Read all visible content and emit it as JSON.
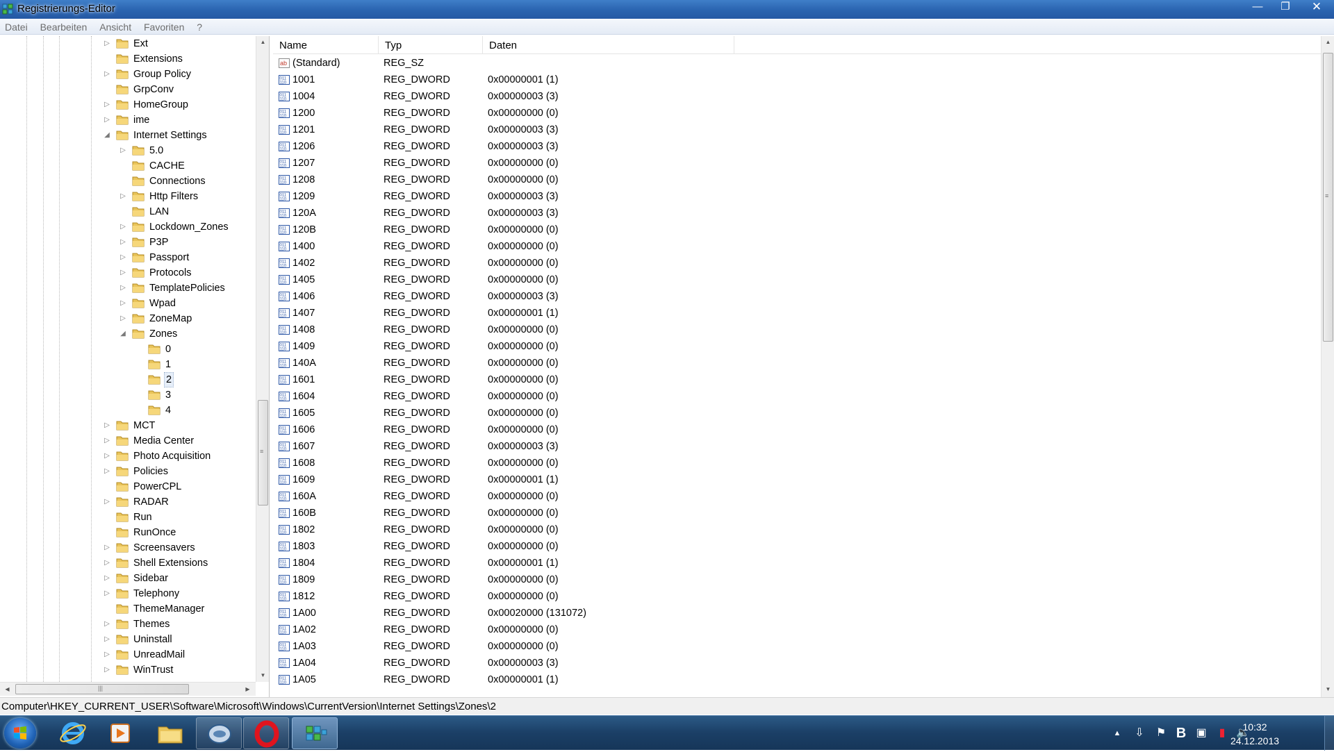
{
  "window": {
    "title": "Registrierungs-Editor",
    "minimize": "—",
    "maximize": "❐",
    "close": "✕"
  },
  "menu": [
    "Datei",
    "Bearbeiten",
    "Ansicht",
    "Favoriten",
    "?"
  ],
  "tree": [
    {
      "label": "Ext",
      "level": 0,
      "exp": "collapsed"
    },
    {
      "label": "Extensions",
      "level": 0,
      "exp": "none"
    },
    {
      "label": "Group Policy",
      "level": 0,
      "exp": "collapsed"
    },
    {
      "label": "GrpConv",
      "level": 0,
      "exp": "none"
    },
    {
      "label": "HomeGroup",
      "level": 0,
      "exp": "collapsed"
    },
    {
      "label": "ime",
      "level": 0,
      "exp": "collapsed"
    },
    {
      "label": "Internet Settings",
      "level": 0,
      "exp": "expanded"
    },
    {
      "label": "5.0",
      "level": 1,
      "exp": "collapsed"
    },
    {
      "label": "CACHE",
      "level": 1,
      "exp": "none"
    },
    {
      "label": "Connections",
      "level": 1,
      "exp": "none"
    },
    {
      "label": "Http Filters",
      "level": 1,
      "exp": "collapsed"
    },
    {
      "label": "LAN",
      "level": 1,
      "exp": "none"
    },
    {
      "label": "Lockdown_Zones",
      "level": 1,
      "exp": "collapsed"
    },
    {
      "label": "P3P",
      "level": 1,
      "exp": "collapsed"
    },
    {
      "label": "Passport",
      "level": 1,
      "exp": "collapsed"
    },
    {
      "label": "Protocols",
      "level": 1,
      "exp": "collapsed"
    },
    {
      "label": "TemplatePolicies",
      "level": 1,
      "exp": "collapsed"
    },
    {
      "label": "Wpad",
      "level": 1,
      "exp": "collapsed"
    },
    {
      "label": "ZoneMap",
      "level": 1,
      "exp": "collapsed"
    },
    {
      "label": "Zones",
      "level": 1,
      "exp": "expanded"
    },
    {
      "label": "0",
      "level": 2,
      "exp": "none"
    },
    {
      "label": "1",
      "level": 2,
      "exp": "none"
    },
    {
      "label": "2",
      "level": 2,
      "exp": "none",
      "selected": true
    },
    {
      "label": "3",
      "level": 2,
      "exp": "none"
    },
    {
      "label": "4",
      "level": 2,
      "exp": "none"
    },
    {
      "label": "MCT",
      "level": 0,
      "exp": "collapsed"
    },
    {
      "label": "Media Center",
      "level": 0,
      "exp": "collapsed"
    },
    {
      "label": "Photo Acquisition",
      "level": 0,
      "exp": "collapsed"
    },
    {
      "label": "Policies",
      "level": 0,
      "exp": "collapsed"
    },
    {
      "label": "PowerCPL",
      "level": 0,
      "exp": "none"
    },
    {
      "label": "RADAR",
      "level": 0,
      "exp": "collapsed"
    },
    {
      "label": "Run",
      "level": 0,
      "exp": "none"
    },
    {
      "label": "RunOnce",
      "level": 0,
      "exp": "none"
    },
    {
      "label": "Screensavers",
      "level": 0,
      "exp": "collapsed"
    },
    {
      "label": "Shell Extensions",
      "level": 0,
      "exp": "collapsed"
    },
    {
      "label": "Sidebar",
      "level": 0,
      "exp": "collapsed"
    },
    {
      "label": "Telephony",
      "level": 0,
      "exp": "collapsed"
    },
    {
      "label": "ThemeManager",
      "level": 0,
      "exp": "none"
    },
    {
      "label": "Themes",
      "level": 0,
      "exp": "collapsed"
    },
    {
      "label": "Uninstall",
      "level": 0,
      "exp": "collapsed"
    },
    {
      "label": "UnreadMail",
      "level": 0,
      "exp": "collapsed"
    },
    {
      "label": "WinTrust",
      "level": 0,
      "exp": "collapsed"
    }
  ],
  "list": {
    "columns": [
      "Name",
      "Typ",
      "Daten"
    ],
    "rows": [
      {
        "name": "(Standard)",
        "type": "REG_SZ",
        "data": "",
        "icon": "string-value-icon"
      },
      {
        "name": "1001",
        "type": "REG_DWORD",
        "data": "0x00000001 (1)",
        "icon": "binary-value-icon"
      },
      {
        "name": "1004",
        "type": "REG_DWORD",
        "data": "0x00000003 (3)",
        "icon": "binary-value-icon"
      },
      {
        "name": "1200",
        "type": "REG_DWORD",
        "data": "0x00000000 (0)",
        "icon": "binary-value-icon"
      },
      {
        "name": "1201",
        "type": "REG_DWORD",
        "data": "0x00000003 (3)",
        "icon": "binary-value-icon"
      },
      {
        "name": "1206",
        "type": "REG_DWORD",
        "data": "0x00000003 (3)",
        "icon": "binary-value-icon"
      },
      {
        "name": "1207",
        "type": "REG_DWORD",
        "data": "0x00000000 (0)",
        "icon": "binary-value-icon"
      },
      {
        "name": "1208",
        "type": "REG_DWORD",
        "data": "0x00000000 (0)",
        "icon": "binary-value-icon"
      },
      {
        "name": "1209",
        "type": "REG_DWORD",
        "data": "0x00000003 (3)",
        "icon": "binary-value-icon"
      },
      {
        "name": "120A",
        "type": "REG_DWORD",
        "data": "0x00000003 (3)",
        "icon": "binary-value-icon"
      },
      {
        "name": "120B",
        "type": "REG_DWORD",
        "data": "0x00000000 (0)",
        "icon": "binary-value-icon"
      },
      {
        "name": "1400",
        "type": "REG_DWORD",
        "data": "0x00000000 (0)",
        "icon": "binary-value-icon"
      },
      {
        "name": "1402",
        "type": "REG_DWORD",
        "data": "0x00000000 (0)",
        "icon": "binary-value-icon"
      },
      {
        "name": "1405",
        "type": "REG_DWORD",
        "data": "0x00000000 (0)",
        "icon": "binary-value-icon"
      },
      {
        "name": "1406",
        "type": "REG_DWORD",
        "data": "0x00000003 (3)",
        "icon": "binary-value-icon"
      },
      {
        "name": "1407",
        "type": "REG_DWORD",
        "data": "0x00000001 (1)",
        "icon": "binary-value-icon"
      },
      {
        "name": "1408",
        "type": "REG_DWORD",
        "data": "0x00000000 (0)",
        "icon": "binary-value-icon"
      },
      {
        "name": "1409",
        "type": "REG_DWORD",
        "data": "0x00000000 (0)",
        "icon": "binary-value-icon"
      },
      {
        "name": "140A",
        "type": "REG_DWORD",
        "data": "0x00000000 (0)",
        "icon": "binary-value-icon"
      },
      {
        "name": "1601",
        "type": "REG_DWORD",
        "data": "0x00000000 (0)",
        "icon": "binary-value-icon"
      },
      {
        "name": "1604",
        "type": "REG_DWORD",
        "data": "0x00000000 (0)",
        "icon": "binary-value-icon"
      },
      {
        "name": "1605",
        "type": "REG_DWORD",
        "data": "0x00000000 (0)",
        "icon": "binary-value-icon"
      },
      {
        "name": "1606",
        "type": "REG_DWORD",
        "data": "0x00000000 (0)",
        "icon": "binary-value-icon"
      },
      {
        "name": "1607",
        "type": "REG_DWORD",
        "data": "0x00000003 (3)",
        "icon": "binary-value-icon"
      },
      {
        "name": "1608",
        "type": "REG_DWORD",
        "data": "0x00000000 (0)",
        "icon": "binary-value-icon"
      },
      {
        "name": "1609",
        "type": "REG_DWORD",
        "data": "0x00000001 (1)",
        "icon": "binary-value-icon"
      },
      {
        "name": "160A",
        "type": "REG_DWORD",
        "data": "0x00000000 (0)",
        "icon": "binary-value-icon"
      },
      {
        "name": "160B",
        "type": "REG_DWORD",
        "data": "0x00000000 (0)",
        "icon": "binary-value-icon"
      },
      {
        "name": "1802",
        "type": "REG_DWORD",
        "data": "0x00000000 (0)",
        "icon": "binary-value-icon"
      },
      {
        "name": "1803",
        "type": "REG_DWORD",
        "data": "0x00000000 (0)",
        "icon": "binary-value-icon"
      },
      {
        "name": "1804",
        "type": "REG_DWORD",
        "data": "0x00000001 (1)",
        "icon": "binary-value-icon"
      },
      {
        "name": "1809",
        "type": "REG_DWORD",
        "data": "0x00000000 (0)",
        "icon": "binary-value-icon"
      },
      {
        "name": "1812",
        "type": "REG_DWORD",
        "data": "0x00000000 (0)",
        "icon": "binary-value-icon"
      },
      {
        "name": "1A00",
        "type": "REG_DWORD",
        "data": "0x00020000 (131072)",
        "icon": "binary-value-icon"
      },
      {
        "name": "1A02",
        "type": "REG_DWORD",
        "data": "0x00000000 (0)",
        "icon": "binary-value-icon"
      },
      {
        "name": "1A03",
        "type": "REG_DWORD",
        "data": "0x00000000 (0)",
        "icon": "binary-value-icon"
      },
      {
        "name": "1A04",
        "type": "REG_DWORD",
        "data": "0x00000003 (3)",
        "icon": "binary-value-icon"
      },
      {
        "name": "1A05",
        "type": "REG_DWORD",
        "data": "0x00000001 (1)",
        "icon": "binary-value-icon"
      }
    ]
  },
  "status": {
    "path": "Computer\\HKEY_CURRENT_USER\\Software\\Microsoft\\Windows\\CurrentVersion\\Internet Settings\\Zones\\2"
  },
  "taskbar": {
    "apps": [
      "internet-explorer-icon",
      "media-player-icon",
      "explorer-icon",
      "messenger-icon",
      "opera-icon",
      "regedit-icon"
    ],
    "tray_icons": [
      "show-hidden-icons-icon",
      "download-icon",
      "action-center-flag-icon",
      "b-app-icon",
      "network-icon",
      "battery-icon",
      "volume-icon"
    ],
    "time": "10:32",
    "date": "24.12.2013"
  },
  "colors": {
    "titlebar": "#2a63b0",
    "taskbar": "#1b3f66",
    "folder": "#e8c25a"
  }
}
